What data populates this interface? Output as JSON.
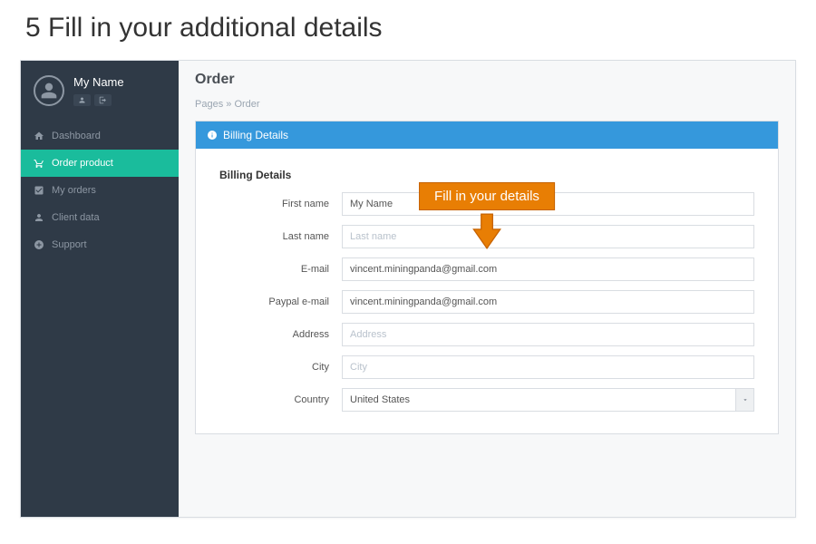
{
  "slide": {
    "title": "5 Fill in your additional details"
  },
  "profile": {
    "name": "My Name"
  },
  "sidebar": {
    "items": [
      {
        "label": "Dashboard"
      },
      {
        "label": "Order product"
      },
      {
        "label": "My orders"
      },
      {
        "label": "Client data"
      },
      {
        "label": "Support"
      }
    ],
    "active_index": 1
  },
  "page": {
    "title": "Order"
  },
  "breadcrumb": {
    "root": "Pages",
    "sep": "»",
    "current": "Order"
  },
  "panel": {
    "header": "Billing Details"
  },
  "callout": {
    "text": "Fill in your details"
  },
  "form": {
    "section_title": "Billing Details",
    "first_name": {
      "label": "First name",
      "value": "My Name"
    },
    "last_name": {
      "label": "Last name",
      "placeholder": "Last name",
      "value": ""
    },
    "email": {
      "label": "E-mail",
      "value": "vincent.miningpanda@gmail.com"
    },
    "paypal_email": {
      "label": "Paypal e-mail",
      "value": "vincent.miningpanda@gmail.com"
    },
    "address": {
      "label": "Address",
      "placeholder": "Address",
      "value": ""
    },
    "city": {
      "label": "City",
      "placeholder": "City",
      "value": ""
    },
    "country": {
      "label": "Country",
      "value": "United States"
    }
  }
}
